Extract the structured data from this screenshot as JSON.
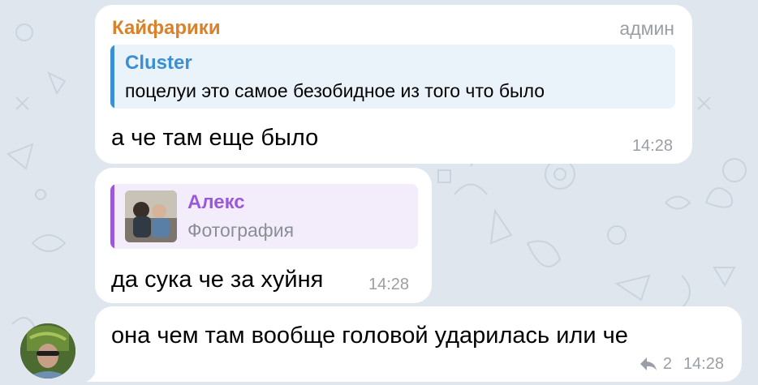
{
  "colors": {
    "background": "#dfe6ee",
    "bubble": "#ffffff",
    "sender_orange": "#d9822b",
    "reply_blue": "#3a8fd6",
    "reply_blue_bg": "#eaf2fa",
    "reply_purple": "#9b59d9",
    "reply_purple_bg": "#f3ecfb",
    "meta_gray": "#9a9fa5"
  },
  "messages": [
    {
      "sender": "Кайфарики",
      "badge": "админ",
      "reply": {
        "name": "Cluster",
        "text": "поцелуи это самое безобидное из того что было"
      },
      "text": "а че там еще было",
      "time": "14:28"
    },
    {
      "reply": {
        "name": "Алекс",
        "text": "Фотография",
        "thumb_icon": "photo-thumbnail"
      },
      "text": "да сука че за хуйня",
      "time": "14:28"
    },
    {
      "text": "она чем там вообще головой ударилась или че",
      "replies_count": "2",
      "replies_icon": "reply-arrow-icon",
      "time": "14:28",
      "avatar_icon": "user-avatar"
    }
  ]
}
